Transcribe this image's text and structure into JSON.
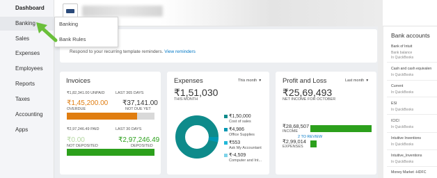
{
  "sidebar": {
    "items": [
      {
        "label": "Dashboard",
        "active": true
      },
      {
        "label": "Banking",
        "active": false
      },
      {
        "label": "Sales",
        "active": false
      },
      {
        "label": "Expenses",
        "active": false
      },
      {
        "label": "Employees",
        "active": false
      },
      {
        "label": "Reports",
        "active": false
      },
      {
        "label": "Taxes",
        "active": false
      },
      {
        "label": "Accounting",
        "active": false
      },
      {
        "label": "Apps",
        "active": false
      }
    ]
  },
  "banking_menu": {
    "items": [
      {
        "label": "Banking"
      },
      {
        "label": "Bank Rules"
      }
    ]
  },
  "reminder": {
    "text": "Respond to your recurring template reminders.",
    "link": "View reminders"
  },
  "invoices": {
    "title": "Invoices",
    "unpaid_label": "₹1,82,341.00 UNPAID",
    "unpaid_period": "LAST 365 DAYS",
    "overdue_amount": "₹1,45,200.00",
    "overdue_label": "OVERDUE",
    "not_due_amount": "₹37,141.00",
    "not_due_label": "NOT DUE YET",
    "paid_label": "₹2,97,246.49 PAID",
    "paid_period": "LAST 30 DAYS",
    "not_deposited_amount": "₹0.00",
    "not_deposited_label": "NOT DEPOSITED",
    "deposited_amount": "₹2,97,246.49",
    "deposited_label": "DEPOSITED",
    "overdue_fraction": 0.8,
    "deposited_fraction": 1.0
  },
  "expenses": {
    "title": "Expenses",
    "period": "This month",
    "total": "₹1,51,030",
    "total_label": "THIS MONTH",
    "legend": [
      {
        "amount": "₹1,50,000",
        "label": "Cost of sales",
        "color": "#0e8b8b"
      },
      {
        "amount": "₹4,986",
        "label": "Office Supplies",
        "color": "#0097b2"
      },
      {
        "amount": "₹553",
        "label": "Ask My Accountant",
        "color": "#21b8d8"
      },
      {
        "amount": "₹-4,509",
        "label": "Computer and Int...",
        "color": "#7fd3e8"
      }
    ]
  },
  "profit_loss": {
    "title": "Profit and Loss",
    "period": "Last month",
    "net_income": "₹25,69,493",
    "net_income_label": "NET INCOME FOR OCTOBER",
    "income_amount": "₹28,68,507",
    "income_label": "INCOME",
    "expenses_amount": "₹2,99,014",
    "expenses_label": "EXPENSES",
    "review_label": "2 TO REVIEW",
    "income_fraction": 1.0,
    "expenses_fraction": 0.1
  },
  "bank_accounts": {
    "title": "Bank accounts",
    "accounts": [
      {
        "name": "Bank of Intuit",
        "line2": "Bank balance",
        "sub": "In QuickBooks"
      },
      {
        "name": "Cash and cash equivalen",
        "line2": "",
        "sub": "In QuickBooks"
      },
      {
        "name": "Current",
        "line2": "",
        "sub": "In QuickBooks"
      },
      {
        "name": "ESI",
        "line2": "",
        "sub": "In QuickBooks"
      },
      {
        "name": "ICICI",
        "line2": "",
        "sub": "In QuickBooks"
      },
      {
        "name": "Intuitive Inventions",
        "line2": "",
        "sub": "In QuickBooks"
      },
      {
        "name": "Intuitive_Inventions",
        "line2": "",
        "sub": "In QuickBooks"
      },
      {
        "name": "Money Market -HDFC",
        "line2": "",
        "sub": ""
      }
    ]
  },
  "colors": {
    "orange": "#e07d10",
    "green": "#2ca01c",
    "link_blue": "#0077c5",
    "arrow_green": "#6abf3a"
  },
  "icons": [
    "company-logo-icon",
    "pointer-arrow-icon",
    "dropdown-caret-icon"
  ]
}
